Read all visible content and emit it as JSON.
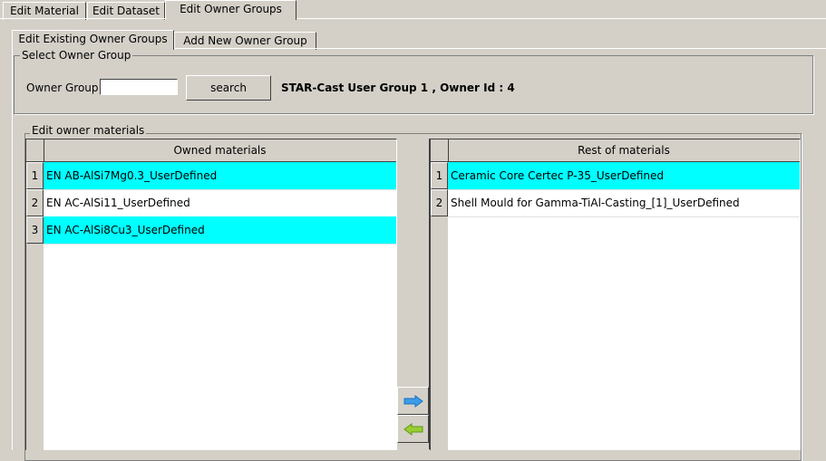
{
  "top_tabs": [
    "Edit Material",
    "Edit Dataset",
    "Edit Owner Groups"
  ],
  "sub_tabs": [
    "Edit Existing Owner Groups",
    "Add New Owner Group"
  ],
  "select_group": {
    "legend": "Select Owner Group",
    "label": "Owner Group",
    "input_value": "",
    "search_label": "search",
    "status": "STAR-Cast User Group 1 , Owner Id : 4"
  },
  "edit_materials": {
    "legend": "Edit owner materials",
    "owned": {
      "header": "Owned materials",
      "rows": [
        {
          "n": "1",
          "name": "EN AB-AlSi7Mg0.3_UserDefined",
          "selected": true
        },
        {
          "n": "2",
          "name": "EN AC-AlSi11_UserDefined",
          "selected": false
        },
        {
          "n": "3",
          "name": "EN AC-AlSi8Cu3_UserDefined",
          "selected": true
        }
      ]
    },
    "rest": {
      "header": "Rest of materials",
      "rows": [
        {
          "n": "1",
          "name": "Ceramic Core Certec P-35_UserDefined",
          "selected": true
        },
        {
          "n": "2",
          "name": "Shell Mould for Gamma-TiAl-Casting_[1]_UserDefined",
          "selected": false
        }
      ]
    },
    "move_right_icon": "arrow-right-icon",
    "move_left_icon": "arrow-left-icon",
    "colors": {
      "selected": "#00ffff"
    }
  }
}
